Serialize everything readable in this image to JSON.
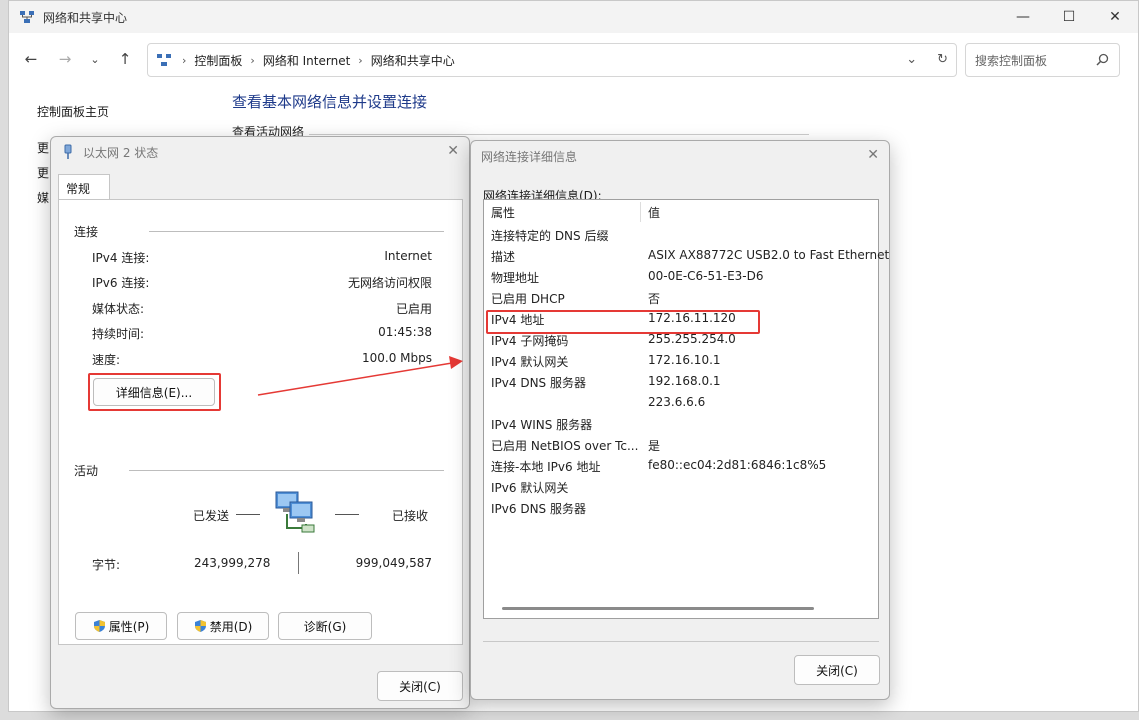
{
  "window": {
    "title": "网络和共享中心",
    "min": "—",
    "max": "☐",
    "close": "✕"
  },
  "address": {
    "crumbs": [
      "控制面板",
      "网络和 Internet",
      "网络和共享中心"
    ],
    "search_placeholder": "搜索控制面板"
  },
  "sidebar": {
    "home": "控制面板主页",
    "item1": "更",
    "item2": "更",
    "item3": "媒"
  },
  "main": {
    "heading": "查看基本网络信息并设置连接",
    "sub": "查看活动网络"
  },
  "status_dialog": {
    "title": "以太网 2 状态",
    "tab": "常规",
    "connection_section": "连接",
    "rows": [
      {
        "label": "IPv4 连接:",
        "value": "Internet"
      },
      {
        "label": "IPv6 连接:",
        "value": "无网络访问权限"
      },
      {
        "label": "媒体状态:",
        "value": "已启用"
      },
      {
        "label": "持续时间:",
        "value": "01:45:38"
      },
      {
        "label": "速度:",
        "value": "100.0 Mbps"
      }
    ],
    "details_button": "详细信息(E)...",
    "activity_section": "活动",
    "sent_label": "已发送",
    "received_label": "已接收",
    "bytes_label": "字节:",
    "bytes_sent": "243,999,278",
    "bytes_received": "999,049,587",
    "properties_button": "属性(P)",
    "disable_button": "禁用(D)",
    "diagnose_button": "诊断(G)",
    "close_button": "关闭(C)"
  },
  "details_dialog": {
    "title": "网络连接详细信息",
    "list_label": "网络连接详细信息(D):",
    "col_property": "属性",
    "col_value": "值",
    "rows": [
      {
        "property": "连接特定的 DNS 后缀",
        "value": ""
      },
      {
        "property": "描述",
        "value": "ASIX AX88772C USB2.0 to Fast Ethernet"
      },
      {
        "property": "物理地址",
        "value": "00-0E-C6-51-E3-D6"
      },
      {
        "property": "已启用 DHCP",
        "value": "否"
      },
      {
        "property": "IPv4 地址",
        "value": "172.16.11.120"
      },
      {
        "property": "IPv4 子网掩码",
        "value": "255.255.254.0"
      },
      {
        "property": "IPv4 默认网关",
        "value": "172.16.10.1"
      },
      {
        "property": "IPv4 DNS 服务器",
        "value": "192.168.0.1"
      },
      {
        "property": "",
        "value": "223.6.6.6"
      },
      {
        "property": "IPv4 WINS 服务器",
        "value": ""
      },
      {
        "property": "已启用 NetBIOS over Tc...",
        "value": "是"
      },
      {
        "property": "连接-本地 IPv6 地址",
        "value": "fe80::ec04:2d81:6846:1c8%5"
      },
      {
        "property": "IPv6 默认网关",
        "value": ""
      },
      {
        "property": "IPv6 DNS 服务器",
        "value": ""
      }
    ],
    "close_button": "关闭(C)"
  },
  "colors": {
    "highlight": "#e53935",
    "heading_blue": "#1e3a8a"
  }
}
